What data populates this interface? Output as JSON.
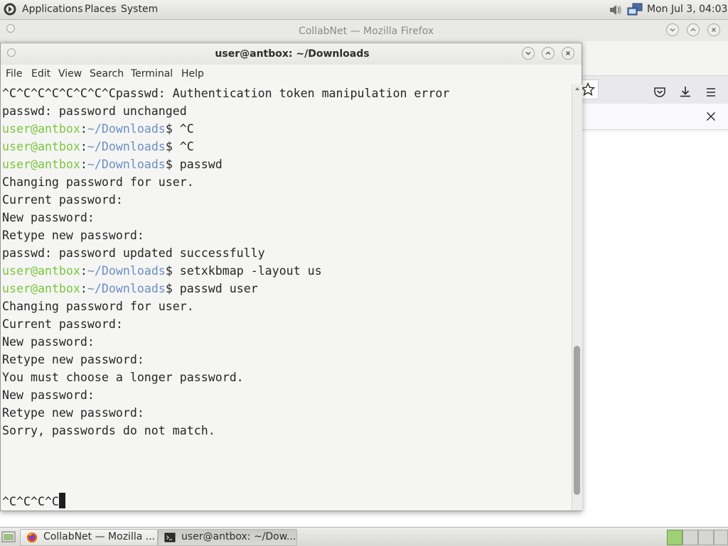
{
  "top_panel": {
    "menus": [
      "Applications",
      "Places",
      "System"
    ],
    "clock": "Mon Jul 3, 04:03"
  },
  "firefox": {
    "title": "CollabNet — Mozilla Firefox"
  },
  "terminal": {
    "title": "user@antbox: ~/Downloads",
    "menus": [
      "File",
      "Edit",
      "View",
      "Search",
      "Terminal",
      "Help"
    ],
    "prompt_user": "user@antbox",
    "prompt_sep": ":",
    "prompt_path": "~/Downloads",
    "prompt_end": "$ ",
    "lines": [
      {
        "type": "text",
        "text": "^C^C^C^C^C^C^C^Cpasswd: Authentication token manipulation error"
      },
      {
        "type": "text",
        "text": "passwd: password unchanged"
      },
      {
        "type": "prompt",
        "cmd": "^C"
      },
      {
        "type": "prompt",
        "cmd": "^C"
      },
      {
        "type": "prompt",
        "cmd": "passwd"
      },
      {
        "type": "text",
        "text": "Changing password for user."
      },
      {
        "type": "text",
        "text": "Current password:"
      },
      {
        "type": "text",
        "text": "New password:"
      },
      {
        "type": "text",
        "text": "Retype new password:"
      },
      {
        "type": "text",
        "text": "passwd: password updated successfully"
      },
      {
        "type": "prompt",
        "cmd": "setxkbmap -layout us"
      },
      {
        "type": "prompt",
        "cmd": "passwd user"
      },
      {
        "type": "text",
        "text": "Changing password for user."
      },
      {
        "type": "text",
        "text": "Current password:"
      },
      {
        "type": "text",
        "text": "New password:"
      },
      {
        "type": "text",
        "text": "Retype new password:"
      },
      {
        "type": "text",
        "text": "You must choose a longer password."
      },
      {
        "type": "text",
        "text": "New password:"
      },
      {
        "type": "text",
        "text": "Retype new password:"
      },
      {
        "type": "text",
        "text": "Sorry, passwords do not match."
      },
      {
        "type": "blank",
        "text": ""
      },
      {
        "type": "blank",
        "text": ""
      },
      {
        "type": "blank",
        "text": ""
      },
      {
        "type": "current",
        "text": "^C^C^C^C"
      }
    ]
  },
  "taskbar": {
    "tasks": [
      {
        "label": "CollabNet — Mozilla ...",
        "icon": "firefox-icon"
      },
      {
        "label": "user@antbox: ~/Dow...",
        "icon": "terminal-icon"
      }
    ]
  },
  "colors": {
    "prompt_user": "#7cc63b",
    "prompt_path": "#6a8fc1",
    "terminal_bg": "#f5f5f4"
  }
}
